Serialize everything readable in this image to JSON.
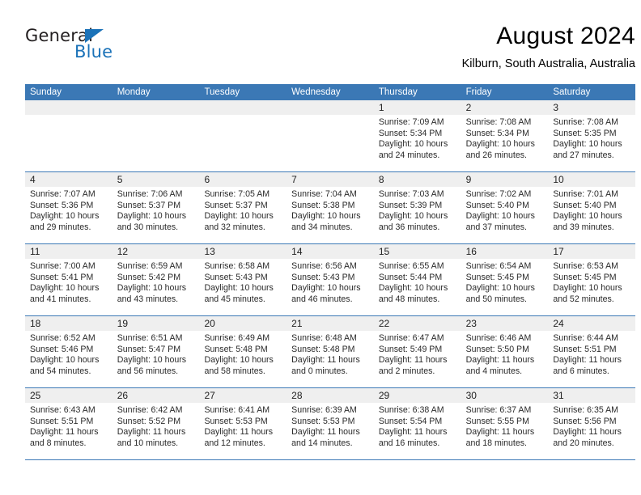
{
  "brand": {
    "name_part1": "General",
    "name_part2": "Blue",
    "accent_color": "#1b72b8",
    "triangle_icon": "triangle-icon"
  },
  "header": {
    "title": "August 2024",
    "location": "Kilburn, South Australia, Australia"
  },
  "calendar": {
    "header_bg": "#3b78b5",
    "daynum_bg": "#efefef",
    "weekdays": [
      "Sunday",
      "Monday",
      "Tuesday",
      "Wednesday",
      "Thursday",
      "Friday",
      "Saturday"
    ],
    "labels": {
      "sunrise": "Sunrise:",
      "sunset": "Sunset:",
      "daylight": "Daylight:"
    },
    "weeks": [
      [
        {
          "day": ""
        },
        {
          "day": ""
        },
        {
          "day": ""
        },
        {
          "day": ""
        },
        {
          "day": "1",
          "sunrise": "Sunrise: 7:09 AM",
          "sunset": "Sunset: 5:34 PM",
          "daylight1": "Daylight: 10 hours",
          "daylight2": "and 24 minutes."
        },
        {
          "day": "2",
          "sunrise": "Sunrise: 7:08 AM",
          "sunset": "Sunset: 5:34 PM",
          "daylight1": "Daylight: 10 hours",
          "daylight2": "and 26 minutes."
        },
        {
          "day": "3",
          "sunrise": "Sunrise: 7:08 AM",
          "sunset": "Sunset: 5:35 PM",
          "daylight1": "Daylight: 10 hours",
          "daylight2": "and 27 minutes."
        }
      ],
      [
        {
          "day": "4",
          "sunrise": "Sunrise: 7:07 AM",
          "sunset": "Sunset: 5:36 PM",
          "daylight1": "Daylight: 10 hours",
          "daylight2": "and 29 minutes."
        },
        {
          "day": "5",
          "sunrise": "Sunrise: 7:06 AM",
          "sunset": "Sunset: 5:37 PM",
          "daylight1": "Daylight: 10 hours",
          "daylight2": "and 30 minutes."
        },
        {
          "day": "6",
          "sunrise": "Sunrise: 7:05 AM",
          "sunset": "Sunset: 5:37 PM",
          "daylight1": "Daylight: 10 hours",
          "daylight2": "and 32 minutes."
        },
        {
          "day": "7",
          "sunrise": "Sunrise: 7:04 AM",
          "sunset": "Sunset: 5:38 PM",
          "daylight1": "Daylight: 10 hours",
          "daylight2": "and 34 minutes."
        },
        {
          "day": "8",
          "sunrise": "Sunrise: 7:03 AM",
          "sunset": "Sunset: 5:39 PM",
          "daylight1": "Daylight: 10 hours",
          "daylight2": "and 36 minutes."
        },
        {
          "day": "9",
          "sunrise": "Sunrise: 7:02 AM",
          "sunset": "Sunset: 5:40 PM",
          "daylight1": "Daylight: 10 hours",
          "daylight2": "and 37 minutes."
        },
        {
          "day": "10",
          "sunrise": "Sunrise: 7:01 AM",
          "sunset": "Sunset: 5:40 PM",
          "daylight1": "Daylight: 10 hours",
          "daylight2": "and 39 minutes."
        }
      ],
      [
        {
          "day": "11",
          "sunrise": "Sunrise: 7:00 AM",
          "sunset": "Sunset: 5:41 PM",
          "daylight1": "Daylight: 10 hours",
          "daylight2": "and 41 minutes."
        },
        {
          "day": "12",
          "sunrise": "Sunrise: 6:59 AM",
          "sunset": "Sunset: 5:42 PM",
          "daylight1": "Daylight: 10 hours",
          "daylight2": "and 43 minutes."
        },
        {
          "day": "13",
          "sunrise": "Sunrise: 6:58 AM",
          "sunset": "Sunset: 5:43 PM",
          "daylight1": "Daylight: 10 hours",
          "daylight2": "and 45 minutes."
        },
        {
          "day": "14",
          "sunrise": "Sunrise: 6:56 AM",
          "sunset": "Sunset: 5:43 PM",
          "daylight1": "Daylight: 10 hours",
          "daylight2": "and 46 minutes."
        },
        {
          "day": "15",
          "sunrise": "Sunrise: 6:55 AM",
          "sunset": "Sunset: 5:44 PM",
          "daylight1": "Daylight: 10 hours",
          "daylight2": "and 48 minutes."
        },
        {
          "day": "16",
          "sunrise": "Sunrise: 6:54 AM",
          "sunset": "Sunset: 5:45 PM",
          "daylight1": "Daylight: 10 hours",
          "daylight2": "and 50 minutes."
        },
        {
          "day": "17",
          "sunrise": "Sunrise: 6:53 AM",
          "sunset": "Sunset: 5:45 PM",
          "daylight1": "Daylight: 10 hours",
          "daylight2": "and 52 minutes."
        }
      ],
      [
        {
          "day": "18",
          "sunrise": "Sunrise: 6:52 AM",
          "sunset": "Sunset: 5:46 PM",
          "daylight1": "Daylight: 10 hours",
          "daylight2": "and 54 minutes."
        },
        {
          "day": "19",
          "sunrise": "Sunrise: 6:51 AM",
          "sunset": "Sunset: 5:47 PM",
          "daylight1": "Daylight: 10 hours",
          "daylight2": "and 56 minutes."
        },
        {
          "day": "20",
          "sunrise": "Sunrise: 6:49 AM",
          "sunset": "Sunset: 5:48 PM",
          "daylight1": "Daylight: 10 hours",
          "daylight2": "and 58 minutes."
        },
        {
          "day": "21",
          "sunrise": "Sunrise: 6:48 AM",
          "sunset": "Sunset: 5:48 PM",
          "daylight1": "Daylight: 11 hours",
          "daylight2": "and 0 minutes."
        },
        {
          "day": "22",
          "sunrise": "Sunrise: 6:47 AM",
          "sunset": "Sunset: 5:49 PM",
          "daylight1": "Daylight: 11 hours",
          "daylight2": "and 2 minutes."
        },
        {
          "day": "23",
          "sunrise": "Sunrise: 6:46 AM",
          "sunset": "Sunset: 5:50 PM",
          "daylight1": "Daylight: 11 hours",
          "daylight2": "and 4 minutes."
        },
        {
          "day": "24",
          "sunrise": "Sunrise: 6:44 AM",
          "sunset": "Sunset: 5:51 PM",
          "daylight1": "Daylight: 11 hours",
          "daylight2": "and 6 minutes."
        }
      ],
      [
        {
          "day": "25",
          "sunrise": "Sunrise: 6:43 AM",
          "sunset": "Sunset: 5:51 PM",
          "daylight1": "Daylight: 11 hours",
          "daylight2": "and 8 minutes."
        },
        {
          "day": "26",
          "sunrise": "Sunrise: 6:42 AM",
          "sunset": "Sunset: 5:52 PM",
          "daylight1": "Daylight: 11 hours",
          "daylight2": "and 10 minutes."
        },
        {
          "day": "27",
          "sunrise": "Sunrise: 6:41 AM",
          "sunset": "Sunset: 5:53 PM",
          "daylight1": "Daylight: 11 hours",
          "daylight2": "and 12 minutes."
        },
        {
          "day": "28",
          "sunrise": "Sunrise: 6:39 AM",
          "sunset": "Sunset: 5:53 PM",
          "daylight1": "Daylight: 11 hours",
          "daylight2": "and 14 minutes."
        },
        {
          "day": "29",
          "sunrise": "Sunrise: 6:38 AM",
          "sunset": "Sunset: 5:54 PM",
          "daylight1": "Daylight: 11 hours",
          "daylight2": "and 16 minutes."
        },
        {
          "day": "30",
          "sunrise": "Sunrise: 6:37 AM",
          "sunset": "Sunset: 5:55 PM",
          "daylight1": "Daylight: 11 hours",
          "daylight2": "and 18 minutes."
        },
        {
          "day": "31",
          "sunrise": "Sunrise: 6:35 AM",
          "sunset": "Sunset: 5:56 PM",
          "daylight1": "Daylight: 11 hours",
          "daylight2": "and 20 minutes."
        }
      ]
    ]
  }
}
